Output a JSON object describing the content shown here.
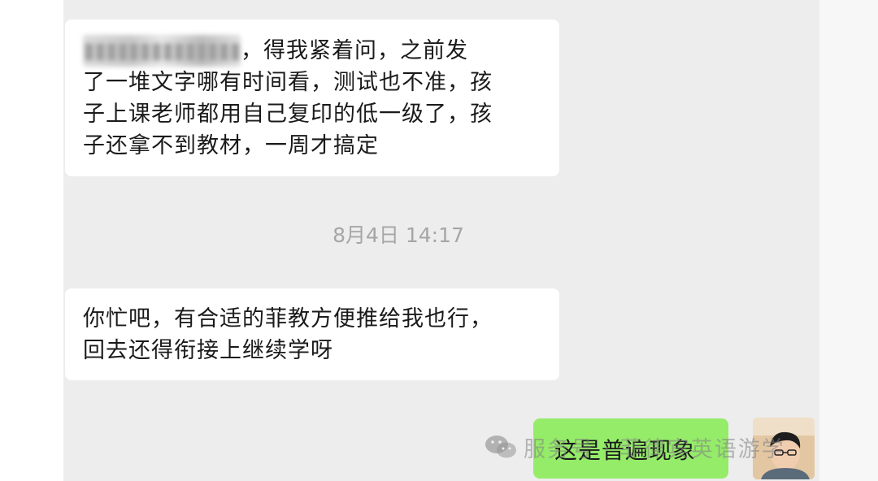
{
  "messages": [
    {
      "direction": "incoming",
      "blurred_prefix": "",
      "lines": [
        "，得我紧着问，之前发",
        "了一堆文字哪有时间看，测试也不准，孩",
        "子上课老师都用自己复印的低一级了，孩",
        "子还拿不到教材，一周才搞定"
      ]
    },
    {
      "direction": "incoming",
      "lines": [
        "你忙吧，有合适的菲教方便推给我也行，",
        "回去还得衔接上继续学呀"
      ]
    },
    {
      "direction": "outgoing",
      "text": "这是普遍现象"
    }
  ],
  "timestamp": "8月4日 14:17",
  "watermark": {
    "icon": "wechat-icon",
    "text": "服务号 · 菲律宾英语游学"
  },
  "colors": {
    "chat_background": "#ededed",
    "incoming_bubble": "#ffffff",
    "outgoing_bubble": "#95ec69",
    "timestamp_text": "#a6a6a6"
  }
}
